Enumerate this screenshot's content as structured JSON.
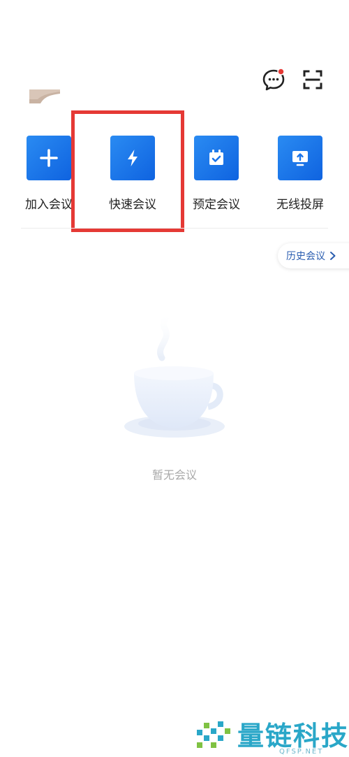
{
  "header": {
    "icons": [
      "message-icon",
      "scan-icon"
    ],
    "message_dot_color": "#e53935"
  },
  "actions": [
    {
      "label": "加入会议",
      "icon": "plus-icon"
    },
    {
      "label": "快速会议",
      "icon": "lightning-icon"
    },
    {
      "label": "预定会议",
      "icon": "calendar-check-icon"
    },
    {
      "label": "无线投屏",
      "icon": "screen-share-icon"
    }
  ],
  "history": {
    "label": "历史会议"
  },
  "empty_state": {
    "text": "暂无会议"
  },
  "watermark": {
    "brand": "量链科技",
    "domain": "QFSP.NET"
  },
  "colors": {
    "tile_blue": "#1a74ea",
    "highlight_red": "#e53935",
    "history_text": "#2a5db0",
    "brand_teal": "#2aa7c8"
  }
}
